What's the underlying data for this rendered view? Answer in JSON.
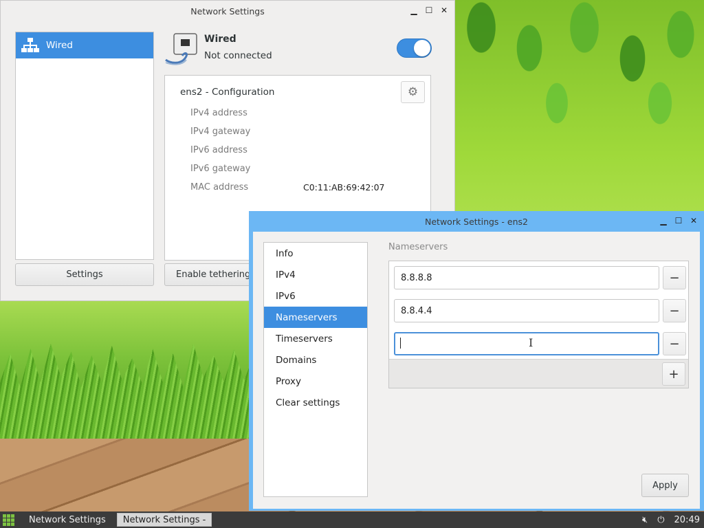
{
  "window1": {
    "title": "Network Settings",
    "sidebar": {
      "items": [
        {
          "label": "Wired"
        }
      ]
    },
    "settings_button": "Settings",
    "tethering_button": "Enable tethering",
    "device": {
      "name": "Wired",
      "status": "Not connected",
      "enabled": true
    },
    "config": {
      "title": "ens2 - Configuration",
      "rows": [
        {
          "label": "IPv4 address",
          "value": ""
        },
        {
          "label": "IPv4 gateway",
          "value": ""
        },
        {
          "label": "IPv6 address",
          "value": ""
        },
        {
          "label": "IPv6 gateway",
          "value": ""
        },
        {
          "label": "MAC address",
          "value": "C0:11:AB:69:42:07"
        }
      ]
    }
  },
  "window2": {
    "title": "Network Settings - ens2",
    "nav": [
      {
        "label": "Info"
      },
      {
        "label": "IPv4"
      },
      {
        "label": "IPv6"
      },
      {
        "label": "Nameservers",
        "selected": true
      },
      {
        "label": "Timeservers"
      },
      {
        "label": "Domains"
      },
      {
        "label": "Proxy"
      },
      {
        "label": "Clear settings"
      }
    ],
    "section_heading": "Nameservers",
    "nameservers": [
      "8.8.8.8",
      "8.8.4.4",
      ""
    ],
    "remove_label": "−",
    "add_label": "+",
    "apply_button": "Apply"
  },
  "taskbar": {
    "tasks": [
      {
        "label": "Network Settings"
      },
      {
        "label": "Network Settings -"
      }
    ],
    "clock": "20:49"
  },
  "colors": {
    "accent": "#3d8ee0",
    "active_titlebar": "#6cb7f4"
  }
}
